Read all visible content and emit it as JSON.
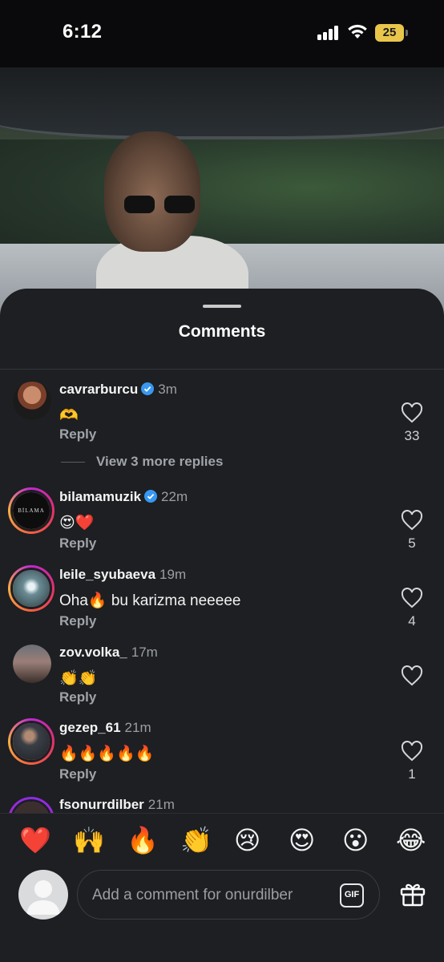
{
  "status": {
    "time": "6:12",
    "battery": "25"
  },
  "sheet": {
    "title": "Comments"
  },
  "comments": [
    {
      "username": "cavrarburcu",
      "verified": true,
      "ago": "3m",
      "text": "🫶",
      "reply": "Reply",
      "likes": "33",
      "more": "View 3 more replies"
    },
    {
      "username": "bilamamuzik",
      "verified": true,
      "ago": "22m",
      "text": "😍❤️",
      "reply": "Reply",
      "likes": "5",
      "avatar_text": "BİLAMA"
    },
    {
      "username": "leile_syubaeva",
      "verified": false,
      "ago": "19m",
      "text": "Oha🔥  bu karizma neeeee",
      "reply": "Reply",
      "likes": "4"
    },
    {
      "username": "zov.volka_",
      "verified": false,
      "ago": "17m",
      "text": "👏👏",
      "reply": "Reply",
      "likes": ""
    },
    {
      "username": "gezep_61",
      "verified": false,
      "ago": "21m",
      "text": "🔥🔥🔥🔥🔥",
      "reply": "Reply",
      "likes": "1"
    },
    {
      "username": "fsonurrdilber",
      "verified": false,
      "ago": "21m"
    }
  ],
  "reactions": [
    "❤️",
    "🙌",
    "🔥",
    "👏",
    "😢",
    "😍",
    "😮",
    "😂"
  ],
  "composer": {
    "placeholder": "Add a comment for onurdilber",
    "gif_label": "GIF"
  },
  "colors": {
    "sheet_bg": "#1d1f22",
    "verified": "#3897f0",
    "secondary_text": "#a0a3a8"
  }
}
